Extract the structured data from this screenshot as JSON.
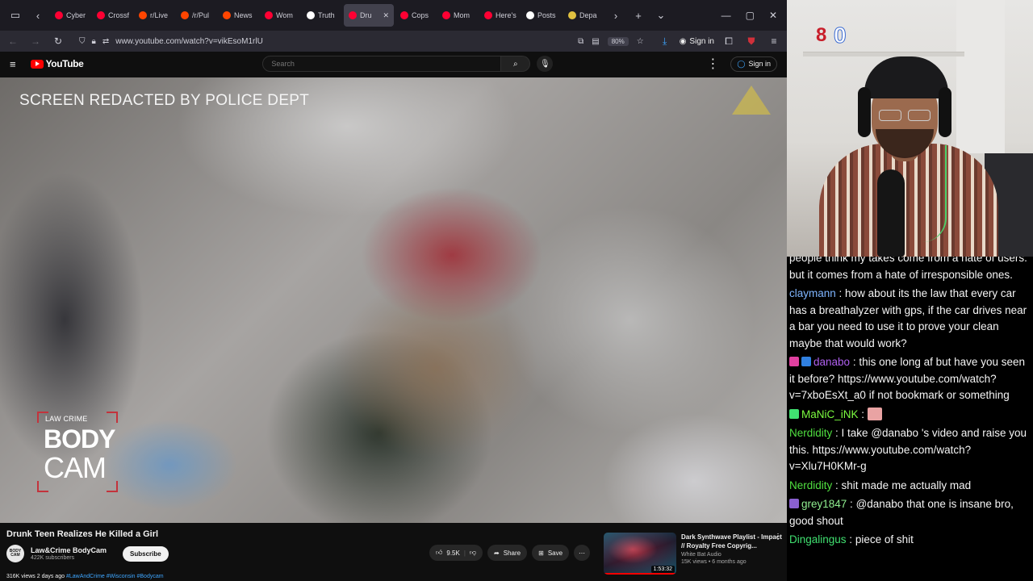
{
  "browser": {
    "tabs": [
      {
        "label": "Cyber",
        "color": "#ff0033",
        "active": false
      },
      {
        "label": "Crossf",
        "color": "#ff0033",
        "active": false
      },
      {
        "label": "r/Live",
        "color": "#ff4500",
        "active": false
      },
      {
        "label": "/r/Pul",
        "color": "#ff4500",
        "active": false
      },
      {
        "label": "News",
        "color": "#ff4500",
        "active": false
      },
      {
        "label": "Wom",
        "color": "#ff0033",
        "active": false
      },
      {
        "label": "Truth",
        "color": "#ffffff",
        "active": false
      },
      {
        "label": "Dru",
        "color": "#ff0033",
        "active": true
      },
      {
        "label": "Cops",
        "color": "#ff0033",
        "active": false
      },
      {
        "label": "Mom",
        "color": "#ff0033",
        "active": false
      },
      {
        "label": "Here's",
        "color": "#ff0033",
        "active": false
      },
      {
        "label": "Posts",
        "color": "#ffffff",
        "active": false
      },
      {
        "label": "Depa",
        "color": "#e0c040",
        "active": false
      }
    ],
    "url": "www.youtube.com/watch?v=vikEsoM1rlU",
    "zoom": "80%",
    "signin_label": "Sign in"
  },
  "yt": {
    "logo_text": "YouTube",
    "search_placeholder": "Search",
    "signin_label": "Sign in"
  },
  "video": {
    "overlay_text": "SCREEN REDACTED BY POLICE DEPT",
    "brand_line": "LAW CRIME",
    "brand_body": "BODY",
    "brand_cam": "CAM"
  },
  "below": {
    "title": "Drunk Teen Realizes He Killed a Girl",
    "channel_name": "Law&Crime BodyCam",
    "channel_subs": "422K subscribers",
    "avatar_text": "BODY CAM",
    "subscribe_label": "Subscribe",
    "likes": "9.5K",
    "share_label": "Share",
    "save_label": "Save",
    "meta_views": "316K views  2 days ago",
    "meta_tags": "#LawAndCrime #Wisconsin #Bodycam"
  },
  "recommended": {
    "title": "Dark Synthwave Playlist - Impact // Royalty Free Copyrig...",
    "channel": "White Bat Audio",
    "stats": "15K views • 6 months ago",
    "duration": "1:53:32"
  },
  "webcam": {
    "logo_a": "8",
    "logo_b": "0"
  },
  "chat": {
    "messages": [
      {
        "user": "",
        "user_color": "#ffffff",
        "badges": [],
        "text": "people think my takes come from a hate of users. but it comes from a hate of irresponsible ones."
      },
      {
        "user": "claymann",
        "user_color": "#7fb5ff",
        "badges": [],
        "text": "how about its the law that every car has a breathalyzer with gps, if the car drives near a bar you need to use it to prove your clean maybe that would work?"
      },
      {
        "user": "danabo",
        "user_color": "#b060f0",
        "badges": [
          "#e040a0",
          "#3080e0"
        ],
        "text": "this one long af but have you seen it before? https://www.youtube.com/watch?v=7xboEsXt_a0 if not bookmark or something"
      },
      {
        "user": "MaNiC_iNK",
        "user_color": "#7cfc40",
        "badges": [
          "#40e070"
        ],
        "text": "",
        "emote": true
      },
      {
        "user": "Nerdidity",
        "user_color": "#50e040",
        "badges": [],
        "text": "I take @danabo 's video and raise you this. https://www.youtube.com/watch?v=Xlu7H0KMr-g"
      },
      {
        "user": "Nerdidity",
        "user_color": "#50e040",
        "badges": [],
        "text": "shit made me actually mad"
      },
      {
        "user": "grey1847",
        "user_color": "#90ee90",
        "badges": [
          "#8a60d0"
        ],
        "text": "@danabo that one is insane bro, good shout"
      },
      {
        "user": "Dingalingus",
        "user_color": "#40e070",
        "badges": [],
        "text": "piece of shit"
      }
    ]
  }
}
